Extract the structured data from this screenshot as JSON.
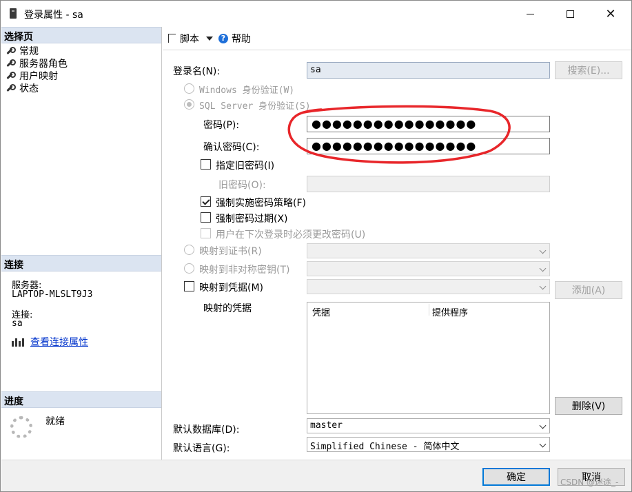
{
  "window": {
    "title": "登录属性 - sa",
    "close_glyph": "✕"
  },
  "left_panel": {
    "select_page_header": "选择页",
    "pages": [
      "常规",
      "服务器角色",
      "用户映射",
      "状态"
    ],
    "connection_header": "连接",
    "server_label": "服务器:",
    "server_value": "LAPTOP-MLSLT9J3",
    "connection_label": "连接:",
    "connection_value": "sa",
    "view_connection_link": "查看连接属性",
    "progress_header": "进度",
    "progress_status": "就绪"
  },
  "toolbar": {
    "script_label": "脚本",
    "help_label": "帮助"
  },
  "form": {
    "login_name_label": "登录名(N):",
    "login_name_value": "sa",
    "search_button": "搜索(E)...",
    "windows_auth": "Windows 身份验证(W)",
    "sql_auth": "SQL Server 身份验证(S)",
    "password_label": "密码(P):",
    "password_value": "●●●●●●●●●●●●●●●●",
    "confirm_password_label": "确认密码(C):",
    "confirm_password_value": "●●●●●●●●●●●●●●●●",
    "specify_old_password": "指定旧密码(I)",
    "old_password_label": "旧密码(O):",
    "enforce_policy": "强制实施密码策略(F)",
    "enforce_expiration": "强制密码过期(X)",
    "must_change": "用户在下次登录时必须更改密码(U)",
    "map_certificate": "映射到证书(R)",
    "map_asym_key": "映射到非对称密钥(T)",
    "map_credential": "映射到凭据(M)",
    "add_button": "添加(A)",
    "mapped_credentials_label": "映射的凭据",
    "grid_columns": [
      "凭据",
      "提供程序"
    ],
    "remove_button": "删除(V)",
    "default_db_label": "默认数据库(D):",
    "default_db_value": "master",
    "default_lang_label": "默认语言(G):",
    "default_lang_value": "Simplified Chinese - 简体中文"
  },
  "footer": {
    "ok_button": "确定",
    "cancel_button": "取消",
    "watermark": "CSDN @迷途_-"
  },
  "colors": {
    "section_header_bg": "#dbe4f1",
    "annotation_red": "#e8262a",
    "link": "#0033cc",
    "accent": "#0078d7"
  }
}
